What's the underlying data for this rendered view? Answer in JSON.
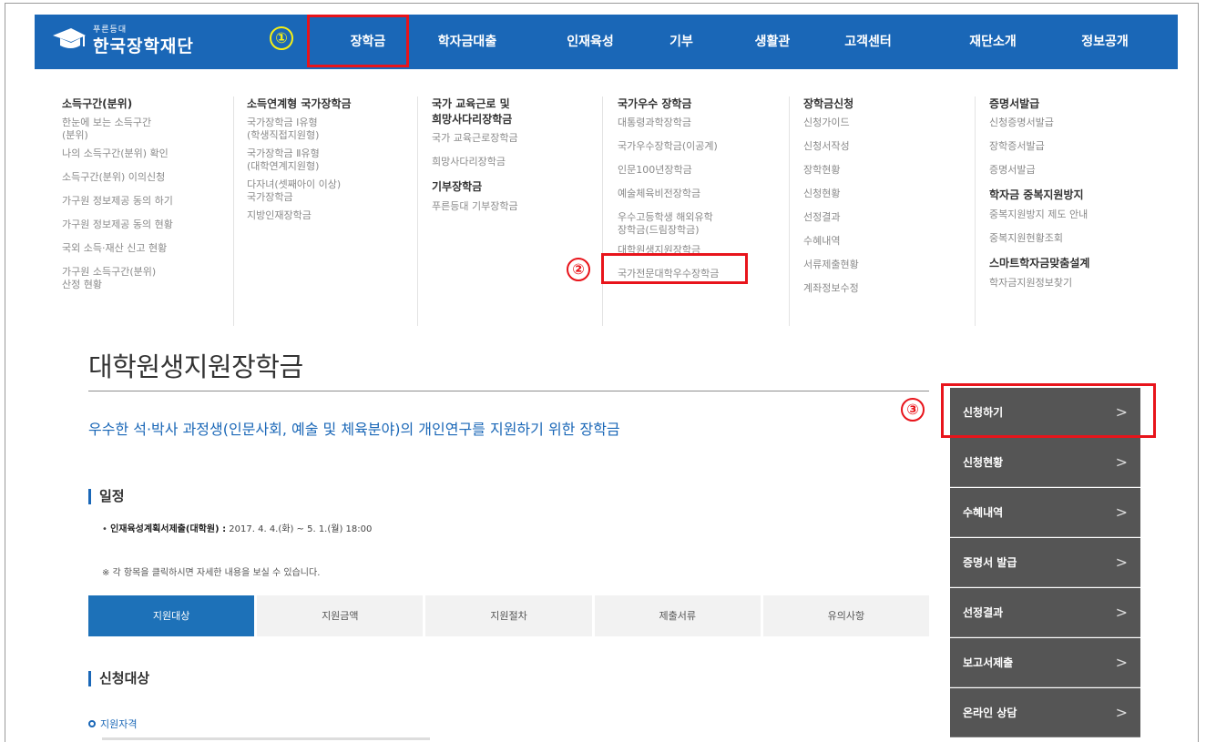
{
  "header": {
    "logo_sub": "푸른등대",
    "logo_name": "한국장학재단",
    "nav": [
      "장학금",
      "학자금대출",
      "인재육성",
      "기부",
      "생활관",
      "고객센터",
      "재단소개",
      "정보공개"
    ]
  },
  "menu": {
    "col1": {
      "title": "소득구간(분위)",
      "items": [
        "한눈에 보는 소득구간\n(분위)",
        "나의 소득구간(분위) 확인",
        "소득구간(분위) 이의신청",
        "가구원 정보제공 동의 하기",
        "가구원 정보제공 동의 현황",
        "국외 소득·재산 신고 현황",
        "가구원 소득구간(분위)\n산정 현황"
      ]
    },
    "col2": {
      "title": "소득연계형 국가장학금",
      "items": [
        "국가장학금 Ⅰ유형\n(학생직접지원형)",
        "국가장학금 Ⅱ유형\n(대학연계지원형)",
        "다자녀(셋째아이 이상)\n국가장학금",
        "지방인재장학금"
      ]
    },
    "col3": {
      "title": "국가 교육근로 및\n희망사다리장학금",
      "items": [
        "국가 교육근로장학금",
        "희망사다리장학금"
      ],
      "title2": "기부장학금",
      "items2": [
        "푸른등대 기부장학금"
      ]
    },
    "col4": {
      "title": "국가우수 장학금",
      "items": [
        "대통령과학장학금",
        "국가우수장학금(이공계)",
        "인문100년장학금",
        "예술체육비전장학금",
        "우수고등학생 해외유학\n장학금(드림장학금)",
        "대학원생지원장학금",
        "국가전문대학우수장학금"
      ]
    },
    "col5": {
      "title": "장학금신청",
      "items": [
        "신청가이드",
        "신청서작성",
        "장학현황",
        "신청현황",
        "선정결과",
        "수혜내역",
        "서류제출현황",
        "계좌정보수정"
      ]
    },
    "col6": {
      "title": "증명서발급",
      "items": [
        "신청증명서발급",
        "장학증서발급",
        "증명서발급"
      ],
      "title2": "학자금 중복지원방지",
      "items2": [
        "중복지원방지 제도 안내",
        "중복지원현황조회"
      ],
      "title3": "스마트학자금맞춤설계",
      "items3": [
        "학자금지원정보찾기"
      ]
    }
  },
  "page": {
    "title": "대학원생지원장학금",
    "intro": "우수한 석·박사 과정생(인문사회, 예술 및 체육분야)의 개인연구를 지원하기 위한 장학금",
    "schedule_heading": "일정",
    "schedule_label": "인재육성계획서제출(대학원) :",
    "schedule_value": " 2017. 4. 4.(화) ~ 5. 1.(월) 18:00",
    "note": "※ 각 항목을 클릭하시면 자세한 내용을 보실 수 있습니다.",
    "tabs": [
      "지원대상",
      "지원금액",
      "지원절차",
      "제출서류",
      "유의사항"
    ],
    "active_tab": 0,
    "apply_heading": "신청대상",
    "qualification": "지원자격"
  },
  "side_menu": [
    "신청하기",
    "신청현황",
    "수혜내역",
    "증명서 발급",
    "선정결과",
    "보고서제출",
    "온라인 상담"
  ],
  "annotations": [
    "①",
    "②",
    "③"
  ],
  "colors": {
    "brand_blue": "#1a67b7",
    "annotation_red": "#e8141b",
    "side_menu_bg": "#555555"
  }
}
